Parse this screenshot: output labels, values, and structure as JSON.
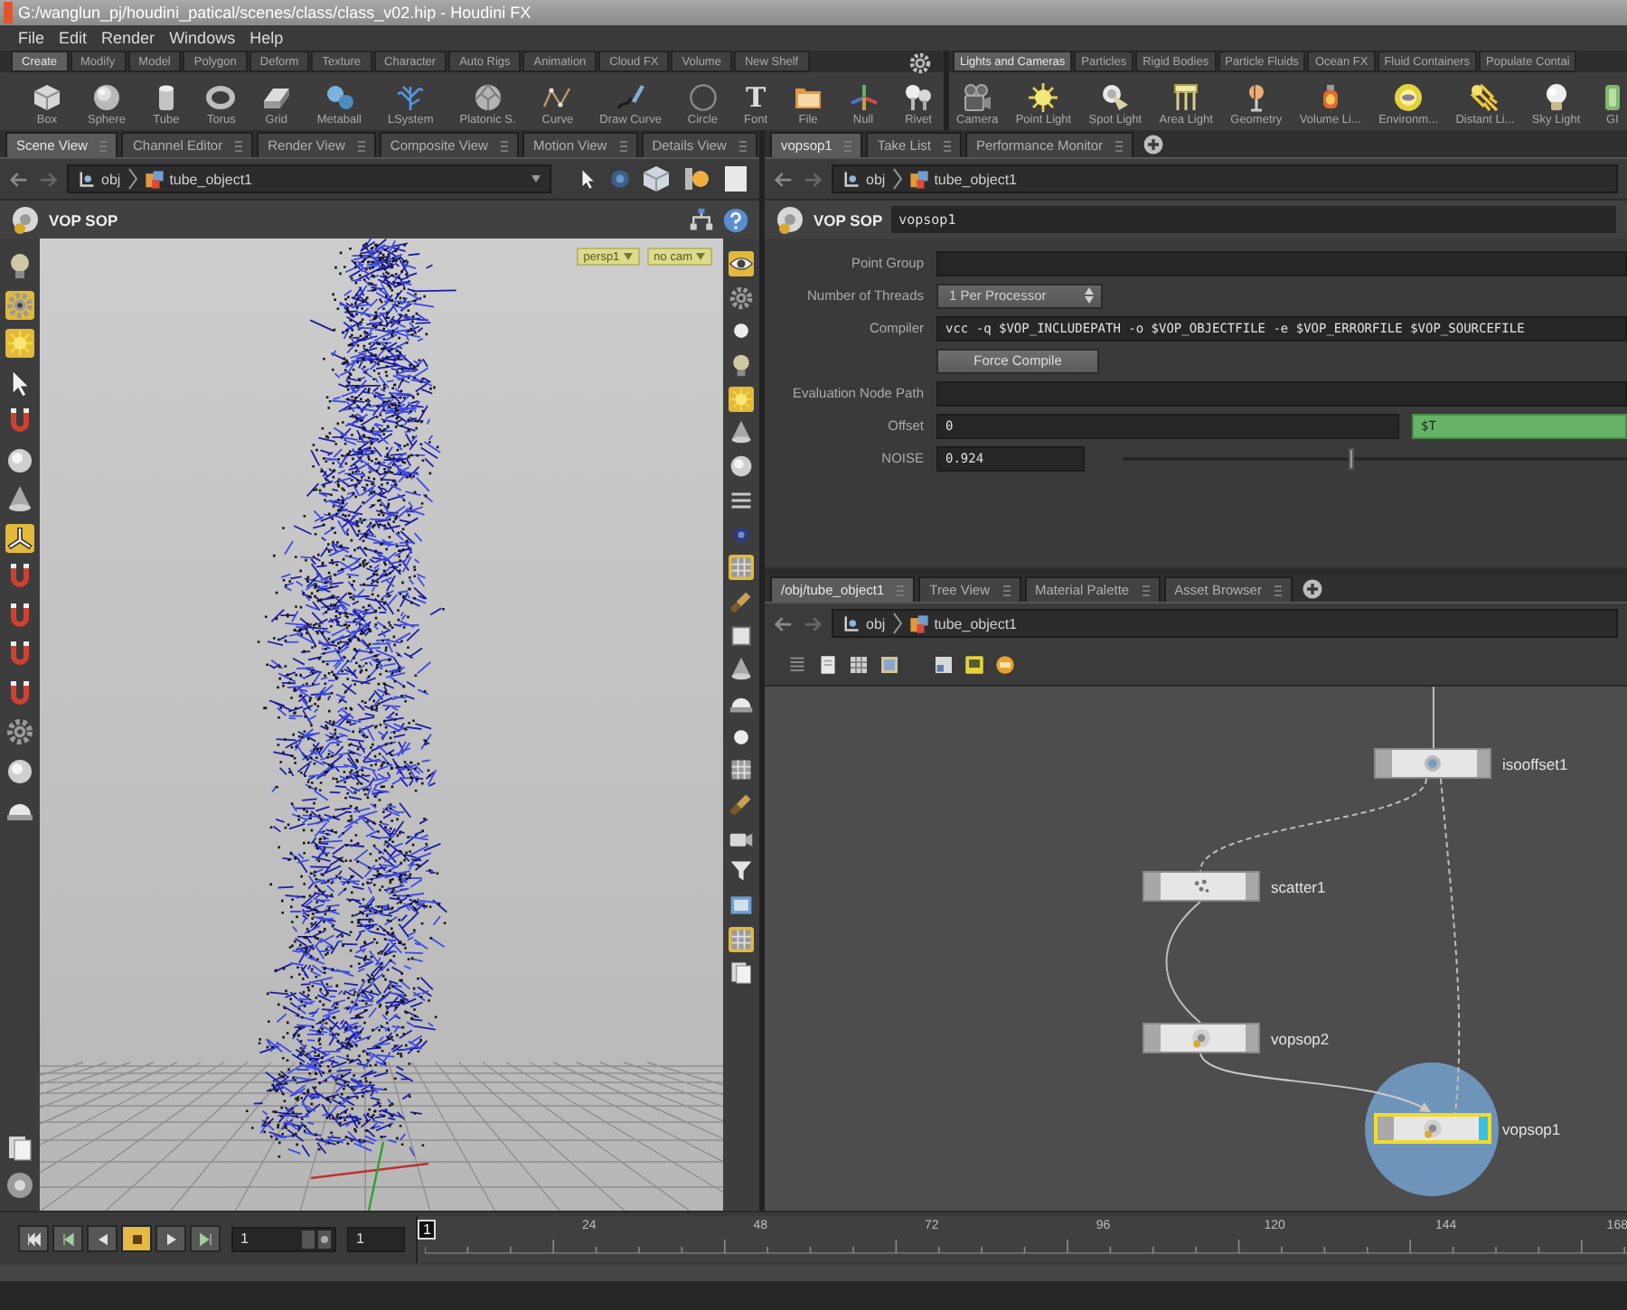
{
  "window": {
    "title": "G:/wanglun_pj/houdini_patical/scenes/class/class_v02.hip - Houdini FX"
  },
  "menu": [
    "File",
    "Edit",
    "Render",
    "Windows",
    "Help"
  ],
  "shelves": [
    {
      "tabs": [
        {
          "label": "Create",
          "selected": true
        },
        {
          "label": "Modify",
          "selected": false
        },
        {
          "label": "Model",
          "selected": false
        },
        {
          "label": "Polygon",
          "selected": false
        },
        {
          "label": "Deform",
          "selected": false
        },
        {
          "label": "Texture",
          "selected": false
        },
        {
          "label": "Character",
          "selected": false
        },
        {
          "label": "Auto Rigs",
          "selected": false
        },
        {
          "label": "Animation",
          "selected": false
        },
        {
          "label": "Cloud FX",
          "selected": false
        },
        {
          "label": "Volume",
          "selected": false
        },
        {
          "label": "New Shelf",
          "selected": false
        }
      ],
      "tools": [
        {
          "kind": "box",
          "label": "Box"
        },
        {
          "kind": "sphere",
          "label": "Sphere"
        },
        {
          "kind": "tube",
          "label": "Tube"
        },
        {
          "kind": "torus",
          "label": "Torus"
        },
        {
          "kind": "grid",
          "label": "Grid"
        },
        {
          "kind": "metaball",
          "label": "Metaball"
        },
        {
          "kind": "lsystem",
          "label": "LSystem"
        },
        {
          "kind": "platonic",
          "label": "Platonic S."
        },
        {
          "kind": "curve",
          "label": "Curve"
        },
        {
          "kind": "drawcurve",
          "label": "Draw Curve"
        },
        {
          "kind": "circle",
          "label": "Circle"
        },
        {
          "kind": "font",
          "label": "Font",
          "glyph": "T"
        },
        {
          "kind": "file",
          "label": "File"
        },
        {
          "kind": "null",
          "label": "Null"
        },
        {
          "kind": "rivet",
          "label": "Rivet"
        }
      ]
    },
    {
      "tabs": [
        {
          "label": "Lights and Cameras",
          "selected": true
        },
        {
          "label": "Particles",
          "selected": false
        },
        {
          "label": "Rigid Bodies",
          "selected": false
        },
        {
          "label": "Particle Fluids",
          "selected": false
        },
        {
          "label": "Ocean FX",
          "selected": false
        },
        {
          "label": "Fluid Containers",
          "selected": false
        },
        {
          "label": "Populate Contai",
          "selected": false
        }
      ],
      "tools": [
        {
          "kind": "camera",
          "label": "Camera"
        },
        {
          "kind": "pointlight",
          "label": "Point Light"
        },
        {
          "kind": "spotlight",
          "label": "Spot Light"
        },
        {
          "kind": "arealight",
          "label": "Area Light"
        },
        {
          "kind": "geometry",
          "label": "Geometry"
        },
        {
          "kind": "volumelight",
          "label": "Volume Li..."
        },
        {
          "kind": "envlight",
          "label": "Environm..."
        },
        {
          "kind": "distantlight",
          "label": "Distant Li..."
        },
        {
          "kind": "skylight",
          "label": "Sky Light"
        },
        {
          "kind": "gilight",
          "label": "GI"
        }
      ]
    }
  ],
  "scene_pane": {
    "tabs": [
      {
        "label": "Scene View",
        "selected": true
      },
      {
        "label": "Channel Editor",
        "selected": false
      },
      {
        "label": "Render View",
        "selected": false
      },
      {
        "label": "Composite View",
        "selected": false
      },
      {
        "label": "Motion View",
        "selected": false
      },
      {
        "label": "Details View",
        "selected": false
      }
    ],
    "path": [
      "obj",
      "tube_object1"
    ],
    "title": "VOP SOP",
    "viewport": {
      "badges": [
        "persp1",
        "no cam"
      ],
      "left_tools": [
        {
          "kind": "bulb",
          "on": false
        },
        {
          "kind": "gear",
          "on": true
        },
        {
          "kind": "sun",
          "on": true
        },
        {
          "kind": "pointer",
          "on": false
        },
        {
          "kind": "magnet",
          "on": false
        },
        {
          "kind": "sphere",
          "on": false
        },
        {
          "kind": "cone",
          "on": false
        },
        {
          "kind": "axes",
          "on": true
        },
        {
          "kind": "magnet",
          "on": false
        },
        {
          "kind": "magnet",
          "on": false
        },
        {
          "kind": "magnet",
          "on": false
        },
        {
          "kind": "magnet",
          "on": false
        },
        {
          "kind": "gear",
          "on": false
        },
        {
          "kind": "sphere",
          "on": false
        },
        {
          "kind": "dome",
          "on": false
        }
      ],
      "left_tools_bottom": [
        {
          "kind": "pages",
          "on": false
        },
        {
          "kind": "disc",
          "on": false
        }
      ],
      "right_tools": [
        {
          "kind": "eye",
          "on": true
        },
        {
          "kind": "gear",
          "on": false
        },
        {
          "kind": "dot",
          "on": false
        },
        {
          "kind": "bulb",
          "on": false
        },
        {
          "kind": "sun",
          "on": true
        },
        {
          "kind": "cone",
          "on": false
        },
        {
          "kind": "sphere",
          "on": false
        },
        {
          "kind": "lines",
          "on": false
        },
        {
          "kind": "target",
          "on": false
        },
        {
          "kind": "grid",
          "on": true
        },
        {
          "kind": "brush",
          "on": false
        },
        {
          "kind": "square",
          "on": false
        },
        {
          "kind": "cone",
          "on": false
        },
        {
          "kind": "dome",
          "on": false
        },
        {
          "kind": "dot",
          "on": false
        },
        {
          "kind": "grid",
          "on": false
        },
        {
          "kind": "brush",
          "on": false
        },
        {
          "kind": "camera",
          "on": false
        },
        {
          "kind": "funnel",
          "on": false
        },
        {
          "kind": "image",
          "on": false
        },
        {
          "kind": "grid",
          "on": true
        },
        {
          "kind": "pages",
          "on": false
        }
      ]
    }
  },
  "param_pane": {
    "tabs": [
      {
        "label": "vopsop1",
        "selected": true
      },
      {
        "label": "Take List",
        "selected": false
      },
      {
        "label": "Performance Monitor",
        "selected": false
      }
    ],
    "path": [
      "obj",
      "tube_object1"
    ],
    "node_type": "VOP SOP",
    "node_name": "vopsop1",
    "params": [
      {
        "kind": "field",
        "label": "Point Group"
      },
      {
        "kind": "menu",
        "label": "Number of Threads",
        "value": "1 Per Processor"
      },
      {
        "kind": "text",
        "label": "Compiler",
        "value": "vcc -q $VOP_INCLUDEPATH -o $VOP_OBJECTFILE -e $VOP_ERRORFILE $VOP_SOURCEFILE"
      },
      {
        "kind": "button",
        "label": "Force Compile"
      },
      {
        "kind": "field",
        "label": "Evaluation Node Path"
      },
      {
        "kind": "expression",
        "label": "Offset",
        "value": "0",
        "expression": "$T"
      },
      {
        "kind": "slider",
        "label": "NOISE",
        "value": "0.924",
        "level": 0.45
      }
    ]
  },
  "network_pane": {
    "tabs": [
      {
        "label": "/obj/tube_object1",
        "selected": true
      },
      {
        "label": "Tree View",
        "selected": false
      },
      {
        "label": "Material Palette",
        "selected": false
      },
      {
        "label": "Asset Browser",
        "selected": false
      }
    ],
    "path": [
      "obj",
      "tube_object1"
    ],
    "nodes": [
      {
        "name": "isooffset1",
        "selected": false
      },
      {
        "name": "scatter1",
        "selected": false
      },
      {
        "name": "vopsop2",
        "selected": false
      },
      {
        "name": "vopsop1",
        "selected": true
      }
    ]
  },
  "timeline": {
    "transport": [
      {
        "kind": "first",
        "selected": false
      },
      {
        "kind": "step_back",
        "selected": false
      },
      {
        "kind": "reverse",
        "selected": false
      },
      {
        "kind": "stop",
        "selected": true
      },
      {
        "kind": "play",
        "selected": false
      },
      {
        "kind": "last",
        "selected": false
      }
    ],
    "frame_fields": [
      "1",
      "1"
    ],
    "marker": "1",
    "ticks": [
      "24",
      "48",
      "72",
      "96",
      "120",
      "144",
      "168"
    ]
  }
}
